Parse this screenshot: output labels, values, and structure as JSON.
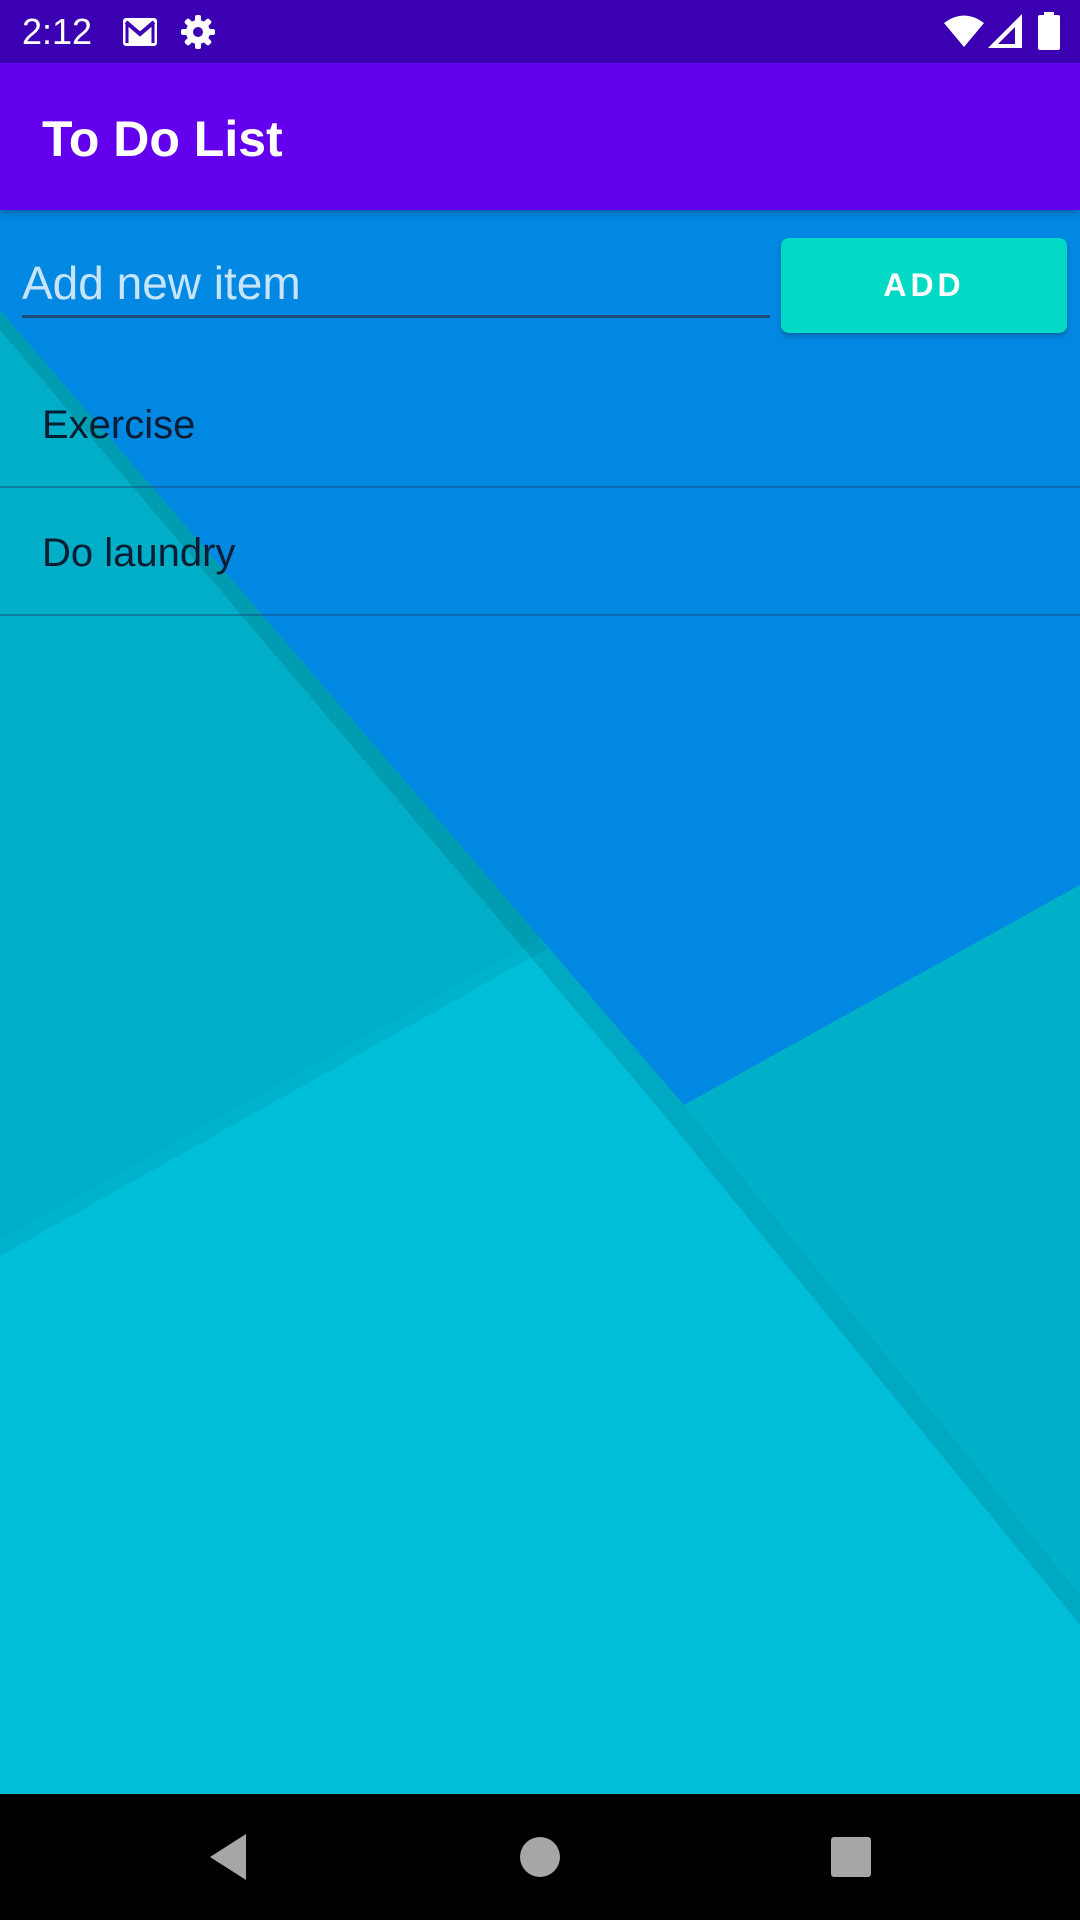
{
  "status_bar": {
    "time": "2:12",
    "left_icons": [
      "gmail-icon",
      "settings-icon"
    ],
    "right_icons": [
      "wifi-icon",
      "signal-icon",
      "battery-icon"
    ]
  },
  "app_bar": {
    "title": "To Do List",
    "background": "#6200ee"
  },
  "input": {
    "placeholder": "Add new item",
    "value": ""
  },
  "add_button": {
    "label": "ADD",
    "color": "#03dac5"
  },
  "todo_items": [
    {
      "label": "Exercise"
    },
    {
      "label": "Do laundry"
    }
  ],
  "nav_bar": {
    "buttons": [
      "back-icon",
      "home-icon",
      "recents-icon"
    ]
  },
  "colors": {
    "status_bar": "#3c00b3",
    "wallpaper_blue": "#0088e0",
    "wallpaper_teal": "#00b0c8",
    "wallpaper_cyan": "#00bcd6"
  }
}
